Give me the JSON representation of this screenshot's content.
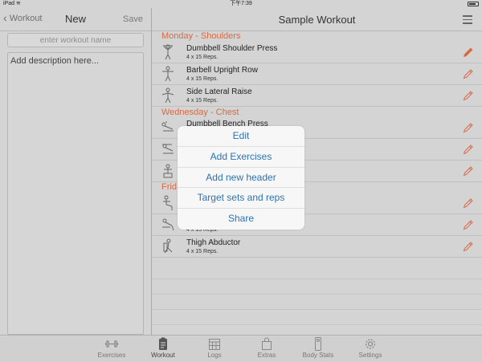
{
  "status_bar": {
    "device": "iPad",
    "wifi_symbol": "≋",
    "time": "下午7:39"
  },
  "left_nav": {
    "back_label": "Workout",
    "title": "New",
    "save_label": "Save"
  },
  "workout_name": {
    "placeholder": "enter workout name",
    "value": ""
  },
  "description": {
    "placeholder": "Add description here...",
    "value": ""
  },
  "right_nav": {
    "title": "Sample Workout"
  },
  "sections": [
    {
      "header": "Monday - Shoulders",
      "exercises": [
        {
          "name": "Dumbbell Shoulder Press",
          "reps": "4 x 15 Reps."
        },
        {
          "name": "Barbell Upright Row",
          "reps": "4 x 15 Reps."
        },
        {
          "name": "Side Lateral Raise",
          "reps": "4 x 15 Reps."
        }
      ]
    },
    {
      "header": "Wednesday - Chest",
      "exercises": [
        {
          "name": "Dumbbell Bench Press",
          "reps": ""
        },
        {
          "name": "",
          "reps": ""
        },
        {
          "name": "",
          "reps": ""
        }
      ]
    },
    {
      "header": "Frid",
      "exercises": [
        {
          "name": "",
          "reps": ""
        },
        {
          "name": "",
          "reps": "4 x 15 Reps."
        },
        {
          "name": "Thigh Abductor",
          "reps": "4 x 15 Reps."
        }
      ]
    }
  ],
  "popup_menu": {
    "items": [
      "Edit",
      "Add Exercises",
      "Add new header",
      "Target sets and reps",
      "Share"
    ]
  },
  "tab_bar": {
    "tabs": [
      {
        "label": "Exercises",
        "icon": "dumbbell-icon"
      },
      {
        "label": "Workout",
        "icon": "clipboard-icon",
        "active": true
      },
      {
        "label": "Logs",
        "icon": "calendar-icon"
      },
      {
        "label": "Extras",
        "icon": "bag-icon"
      },
      {
        "label": "Body Stats",
        "icon": "scale-icon"
      },
      {
        "label": "Settings",
        "icon": "gear-icon"
      }
    ]
  },
  "colors": {
    "accent": "#d86a43",
    "link": "#2b73b3",
    "background": "#d4d4d4"
  }
}
